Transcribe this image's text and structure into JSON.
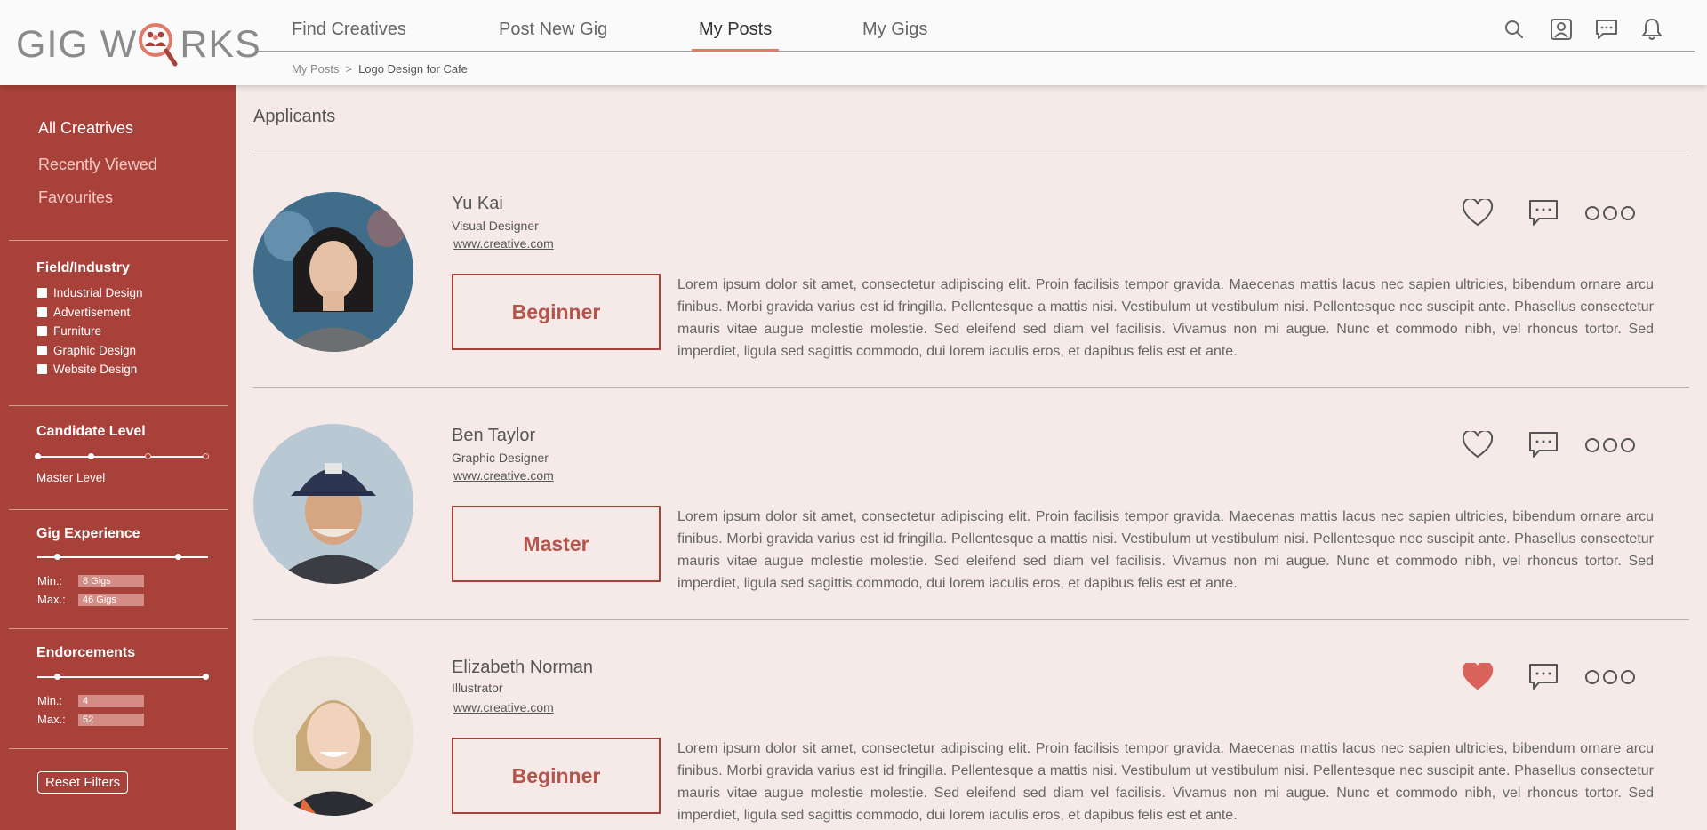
{
  "logo": {
    "left": "GIG W",
    "right": "RKS"
  },
  "nav": {
    "items": [
      "Find Creatives",
      "Post New Gig",
      "My Posts",
      "My Gigs"
    ],
    "active_index": 2
  },
  "breadcrumb": {
    "parent": "My Posts",
    "separator": ">",
    "current": "Logo Design for Cafe"
  },
  "icons": [
    "search-icon",
    "profile-icon",
    "messages-icon",
    "bell-icon"
  ],
  "sidebar": {
    "links": [
      "All Creatrives",
      "Recently Viewed",
      "Favourites"
    ],
    "field_title": "Field/Industry",
    "fields": [
      "Industrial Design",
      "Advertisement",
      "Furniture",
      "Graphic Design",
      "Website Design"
    ],
    "candidate_title": "Candidate Level",
    "candidate_value": "Master Level",
    "gig_title": "Gig Experience",
    "gig_min_label": "Min.:",
    "gig_min": "8 Gigs",
    "gig_max_label": "Max.:",
    "gig_max": "46 Gigs",
    "endorse_title": "Endorcements",
    "endorse_min_label": "Min.:",
    "endorse_min": "4",
    "endorse_max_label": "Max.:",
    "endorse_max": "52",
    "reset": "Reset Filters"
  },
  "main": {
    "title": "Applicants",
    "applicants": [
      {
        "name": "Yu Kai",
        "role": "Visual Designer",
        "site": "www.creative.com",
        "level": "Beginner",
        "favourite": false,
        "desc": "Lorem ipsum dolor sit amet, consectetur adipiscing elit. Proin facilisis tempor gravida. Maecenas mattis lacus nec sapien ultricies, bibendum ornare arcu finibus. Morbi gravida varius est id fringilla. Pellentesque a mattis nisi. Vestibulum ut vestibulum nisi. Pellentesque nec suscipit ante. Phasellus consectetur mauris vitae augue molestie molestie. Sed eleifend sed diam vel facilisis. Vivamus non mi augue. Nunc et commodo nibh, vel rhoncus tortor. Sed imperdiet, ligula sed sagittis commodo, dui lorem iaculis eros, et dapibus felis est et ante."
      },
      {
        "name": "Ben Taylor",
        "role": "Graphic Designer",
        "site": "www.creative.com",
        "level": "Master",
        "favourite": false,
        "desc": "Lorem ipsum dolor sit amet, consectetur adipiscing elit. Proin facilisis tempor gravida. Maecenas mattis lacus nec sapien ultricies, bibendum ornare arcu finibus. Morbi gravida varius est id fringilla. Pellentesque a mattis nisi. Vestibulum ut vestibulum nisi. Pellentesque nec suscipit ante. Phasellus consectetur mauris vitae augue molestie molestie. Sed eleifend sed diam vel facilisis. Vivamus non mi augue. Nunc et commodo nibh, vel rhoncus tortor. Sed imperdiet, ligula sed sagittis commodo, dui lorem iaculis eros, et dapibus felis est et ante."
      },
      {
        "name": "Elizabeth Norman",
        "role": "Illustrator",
        "site": "www.creative.com",
        "level": "Beginner",
        "favourite": true,
        "desc": "Lorem ipsum dolor sit amet, consectetur adipiscing elit. Proin facilisis tempor gravida. Maecenas mattis lacus nec sapien ultricies, bibendum ornare arcu finibus. Morbi gravida varius est id fringilla. Pellentesque a mattis nisi. Vestibulum ut vestibulum nisi. Pellentesque nec suscipit ante. Phasellus consectetur mauris vitae augue molestie molestie. Sed eleifend sed diam vel facilisis. Vivamus non mi augue. Nunc et commodo nibh, vel rhoncus tortor. Sed imperdiet, ligula sed sagittis commodo, dui lorem iaculis eros, et dapibus felis est et ante."
      }
    ]
  },
  "colors": {
    "sidebar": "#a8413a",
    "accent": "#e07a6a",
    "favourite": "#d9625a",
    "background": "#f5eae8"
  }
}
